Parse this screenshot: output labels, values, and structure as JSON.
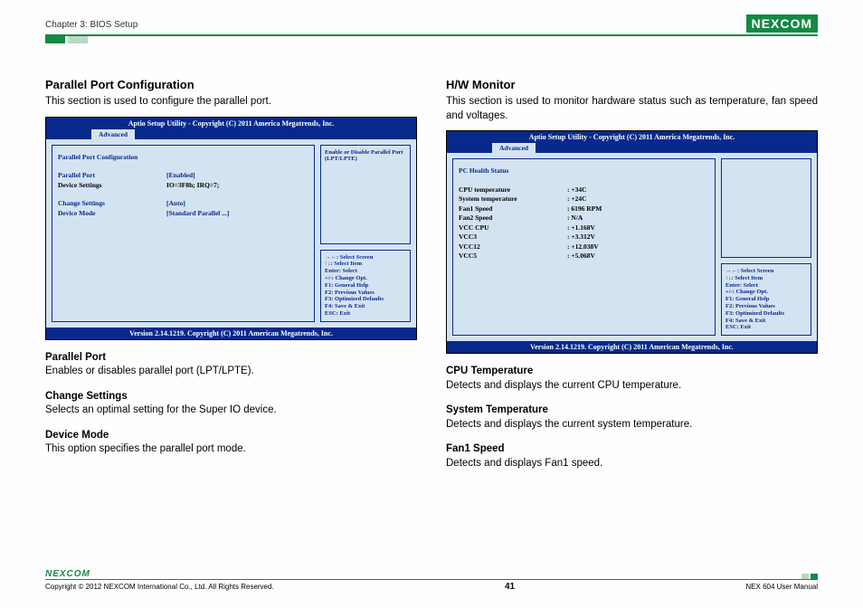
{
  "header": {
    "chapter": "Chapter 3: BIOS Setup",
    "logo": "NEXCOM"
  },
  "left": {
    "title": "Parallel Port Configuration",
    "intro": "This section is used to configure the parallel port.",
    "bios": {
      "title": "Aptio Setup Utility - Copyright (C) 2011 America Megatrends, Inc.",
      "tab": "Advanced",
      "heading": "Parallel Port Configuration",
      "rows": [
        {
          "k": "Parallel Port",
          "v": "[Enabled]"
        }
      ],
      "black_row": {
        "k": "Device Settings",
        "v": "IO=3F8h; IRQ=7;"
      },
      "rows2": [
        {
          "k": "Change Settings",
          "v": "[Auto]"
        },
        {
          "k": "Device Mode",
          "v": "[Standard Parallel ...]"
        }
      ],
      "help": "Enable or Disable Parallel Port (LPT/LPTE)",
      "keys": [
        "→←: Select Screen",
        "↑↓: Select Item",
        "Enter: Select",
        "+/-: Change Opt.",
        "F1: General Help",
        "F2: Previous Values",
        "F3: Optimized Defaults",
        "F4: Save & Exit",
        "ESC: Exit"
      ],
      "footer": "Version 2.14.1219. Copyright (C) 2011 American Megatrends, Inc."
    },
    "descs": [
      {
        "h": "Parallel Port",
        "p": "Enables or disables parallel port (LPT/LPTE)."
      },
      {
        "h": "Change Settings",
        "p": "Selects an optimal setting for the Super IO device."
      },
      {
        "h": "Device Mode",
        "p": "This option specifies the parallel port mode."
      }
    ]
  },
  "right": {
    "title": "H/W Monitor",
    "intro": "This section is used to monitor hardware status such as temperature, fan speed and voltages.",
    "bios": {
      "title": "Aptio Setup Utility - Copyright (C) 2011 America Megatrends, Inc.",
      "tab": "Advanced",
      "heading": "PC Health Status",
      "stats": [
        {
          "k": "CPU temperature",
          "v": ":  +34C"
        },
        {
          "k": "System temperature",
          "v": ":  +24C"
        },
        {
          "k": "Fan1 Speed",
          "v": ":  6196 RPM"
        },
        {
          "k": "Fan2 Speed",
          "v": ":  N/A"
        },
        {
          "k": "VCC CPU",
          "v": ":  +1.168V"
        },
        {
          "k": "VCC3",
          "v": ":  +3.312V"
        },
        {
          "k": "VCC12",
          "v": ":  +12.038V"
        },
        {
          "k": "VCC5",
          "v": ":  +5.068V"
        }
      ],
      "keys": [
        "→←: Select Screen",
        "↑↓: Select Item",
        "Enter: Select",
        "+/-: Change Opt.",
        "F1: General Help",
        "F2: Previous Values",
        "F3: Optimized Defaults",
        "F4: Save & Exit",
        "ESC: Exit"
      ],
      "footer": "Version 2.14.1219. Copyright (C) 2011 American Megatrends, Inc."
    },
    "descs": [
      {
        "h": "CPU Temperature",
        "p": "Detects and displays the current CPU temperature."
      },
      {
        "h": "System Temperature",
        "p": "Detects and displays the current system temperature."
      },
      {
        "h": "Fan1 Speed",
        "p": "Detects and displays Fan1 speed."
      }
    ]
  },
  "footer": {
    "logo": "NEXCOM",
    "copyright": "Copyright © 2012 NEXCOM International Co., Ltd. All Rights Reserved.",
    "page": "41",
    "doc": "NEX 604 User Manual"
  }
}
